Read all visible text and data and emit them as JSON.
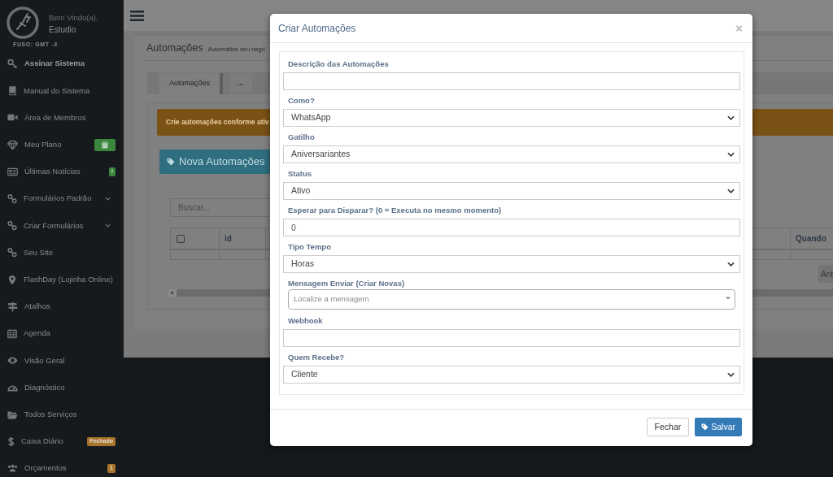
{
  "sidebar": {
    "greeting": "Bem Vindo(a),",
    "user": "Estudio",
    "timezone": "FUSO: GMT -3",
    "items": [
      {
        "label": "Assinar Sistema",
        "highlighted": true,
        "submenu": false
      },
      {
        "label": "Manual do Sistema",
        "highlighted": false,
        "submenu": false
      },
      {
        "label": "Área de Membros",
        "highlighted": false,
        "submenu": false
      },
      {
        "label": "Meu Plano",
        "highlighted": false,
        "submenu": false,
        "badge": {
          "kind": "gift",
          "color": "#3a873d"
        }
      },
      {
        "label": "Últimas Notícias",
        "highlighted": false,
        "submenu": false,
        "badge": {
          "kind": "text",
          "text": "!",
          "color": "#3a873d"
        }
      },
      {
        "label": "Formulários Padrão",
        "highlighted": false,
        "submenu": true
      },
      {
        "label": "Criar Formulários",
        "highlighted": false,
        "submenu": true
      },
      {
        "label": "Seu Site",
        "highlighted": false,
        "submenu": false
      },
      {
        "label": "FlashDay (Lojinha Online)",
        "highlighted": false,
        "submenu": false
      },
      {
        "label": "Atalhos",
        "highlighted": false,
        "submenu": false
      },
      {
        "label": "Agenda",
        "highlighted": false,
        "submenu": false
      },
      {
        "label": "Visão Geral",
        "highlighted": false,
        "submenu": false
      },
      {
        "label": "Diagnóstico",
        "highlighted": false,
        "submenu": false
      },
      {
        "label": "Todos Serviços",
        "highlighted": false,
        "submenu": false
      },
      {
        "label": "Caixa Diário",
        "highlighted": false,
        "submenu": false,
        "badge": {
          "kind": "text",
          "text": "Fechado",
          "color": "#a8742c"
        }
      },
      {
        "label": "Orçamentos",
        "highlighted": false,
        "submenu": false,
        "badge": {
          "kind": "text",
          "text": "1",
          "color": "#a8742c"
        }
      }
    ]
  },
  "page": {
    "title": "Automações",
    "subtitle": "Automatize seu negó",
    "tabs": [
      {
        "label": "Automações",
        "selected": true
      },
      {
        "label": "...",
        "selected": false
      }
    ],
    "alert": "Crie automações conforme ativ",
    "new_button": "Nova Automações",
    "search": {
      "placeholder": "Buscar..."
    },
    "table": {
      "columns": [
        {
          "kind": "checkbox",
          "checked": false
        },
        {
          "kind": "text",
          "label": "id"
        },
        {
          "kind": "text",
          "label": "Quando"
        }
      ]
    },
    "pagination": [
      {
        "label": "Ant"
      }
    ]
  },
  "modal": {
    "title": "Criar Automações",
    "close": "×",
    "fields": [
      {
        "label": "Descrição das Automações",
        "kind": "text"
      },
      {
        "label": "Como?",
        "kind": "select",
        "value": "WhatsApp"
      },
      {
        "label": "Gatilho",
        "kind": "select",
        "value": "Aniversariantes"
      },
      {
        "label": "Status",
        "kind": "select",
        "value": "Ativo"
      },
      {
        "label": "Esperar para Disparar? (0 = Executa no mesmo momento)",
        "kind": "text",
        "value": "0"
      },
      {
        "label": "Tipo Tempo",
        "kind": "select",
        "value": "Horas"
      },
      {
        "label": "Mensagem Enviar (Criar Novas)",
        "kind": "search_select",
        "placeholder": "Localize a mensagem"
      },
      {
        "label": "Webhook",
        "kind": "text"
      },
      {
        "label": "Quem Recebe?",
        "kind": "select",
        "value": "Cliente"
      }
    ],
    "buttons": [
      {
        "label": "Fechar",
        "kind": "default"
      },
      {
        "label": "Salvar",
        "kind": "primary"
      }
    ]
  }
}
